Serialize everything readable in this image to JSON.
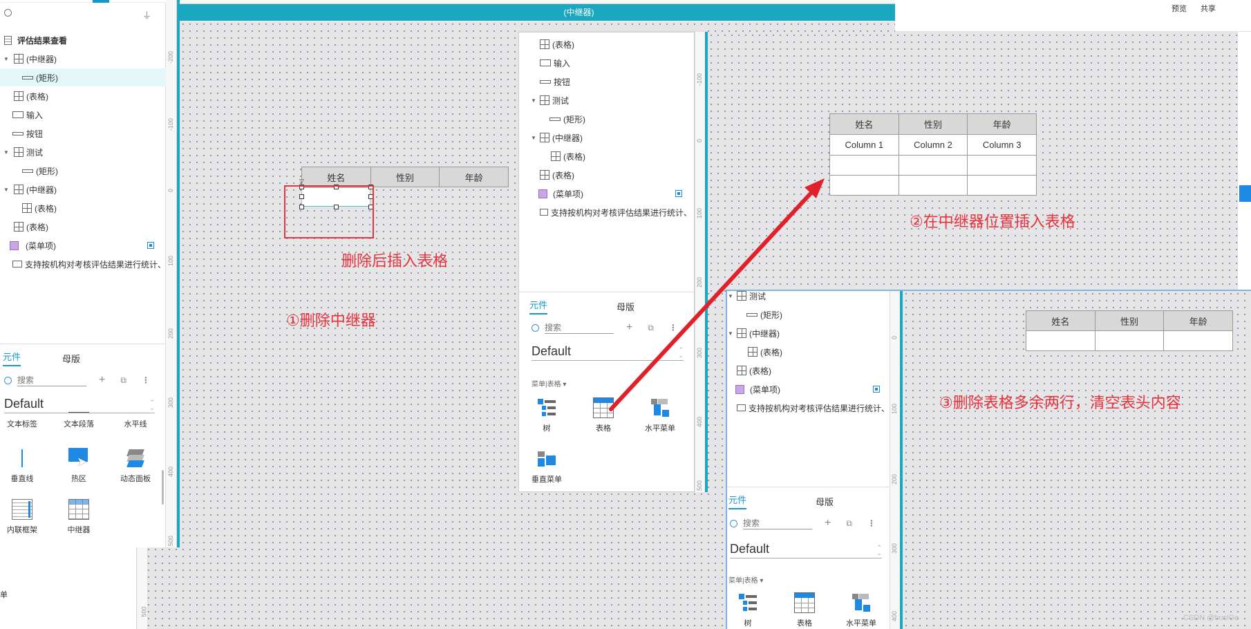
{
  "top_bar": {
    "preview": "预览",
    "share": "共享"
  },
  "canvas": {
    "repeater_title": "(中继器)"
  },
  "left_panel": {
    "outline_title": "评估结果查看",
    "tree": [
      {
        "label": "(中继器)",
        "icon": "grid-icon",
        "caret": "▼"
      },
      {
        "label": "(矩形)",
        "icon": "rect-icon",
        "caret": ""
      },
      {
        "label": "(表格)",
        "icon": "grid-icon",
        "caret": ""
      },
      {
        "label": "输入",
        "icon": "input-icon",
        "caret": ""
      },
      {
        "label": "按钮",
        "icon": "rect-icon",
        "caret": ""
      },
      {
        "label": "测试",
        "icon": "grid-icon",
        "caret": "▼"
      },
      {
        "label": "(矩形)",
        "icon": "rect-icon",
        "caret": ""
      },
      {
        "label": "(中继器)",
        "icon": "grid-icon",
        "caret": "▼"
      },
      {
        "label": "(表格)",
        "icon": "grid-icon",
        "caret": ""
      },
      {
        "label": "(表格)",
        "icon": "grid-icon",
        "caret": ""
      },
      {
        "label": "(菜单项)",
        "icon": "menu-icon",
        "caret": ""
      },
      {
        "label": "支持按机构对考核评估结果进行统计、",
        "icon": "input-icon",
        "caret": ""
      }
    ],
    "tabs": [
      "元件",
      "母版"
    ],
    "search_placeholder": "搜索",
    "library": "Default",
    "components": [
      {
        "label": "文本标签",
        "icon": "text-label-icon"
      },
      {
        "label": "文本段落",
        "icon": "text-paragraph-icon"
      },
      {
        "label": "水平线",
        "icon": "horizontal-line-icon"
      },
      {
        "label": "垂直线",
        "icon": "vertical-line-icon"
      },
      {
        "label": "热区",
        "icon": "hotspot-icon"
      },
      {
        "label": "动态面板",
        "icon": "dynamic-panel-icon"
      },
      {
        "label": "内联框架",
        "icon": "inline-frame-icon"
      },
      {
        "label": "中继器",
        "icon": "repeater-icon"
      }
    ]
  },
  "ruler_labels": {
    "left_v": [
      "-200",
      "-100",
      "0",
      "100",
      "200",
      "300",
      "400",
      "500"
    ],
    "mid_v": [
      "-100",
      "0",
      "100",
      "200",
      "300",
      "400",
      "500"
    ],
    "right_v": [
      "0",
      "100",
      "200",
      "300",
      "400"
    ],
    "bottom_left_v": [
      "500"
    ]
  },
  "table1": {
    "headers": [
      "姓名",
      "性别",
      "年龄"
    ]
  },
  "annotations": {
    "a1": "①删除中继器",
    "a2": "删除后插入表格",
    "a3": "②在中继器位置插入表格",
    "a4": "③删除表格多余两行，清空表头内容"
  },
  "mid_panel": {
    "tree": [
      {
        "label": "(表格)",
        "icon": "grid-icon",
        "caret": ""
      },
      {
        "label": "输入",
        "icon": "input-icon",
        "caret": ""
      },
      {
        "label": "按钮",
        "icon": "rect-icon",
        "caret": ""
      },
      {
        "label": "测试",
        "icon": "grid-icon",
        "caret": "▼"
      },
      {
        "label": "(矩形)",
        "icon": "rect-icon",
        "caret": ""
      },
      {
        "label": "(中继器)",
        "icon": "grid-icon",
        "caret": "▼"
      },
      {
        "label": "(表格)",
        "icon": "grid-icon",
        "caret": ""
      },
      {
        "label": "(表格)",
        "icon": "grid-icon",
        "caret": ""
      },
      {
        "label": "(菜单项)",
        "icon": "menu-icon",
        "caret": ""
      },
      {
        "label": "支持按机构对考核评估结果进行统计、",
        "icon": "input-icon",
        "caret": ""
      }
    ],
    "tabs": [
      "元件",
      "母版"
    ],
    "search_placeholder": "搜索",
    "library": "Default",
    "category": "菜单|表格 ▾",
    "components": [
      {
        "label": "树",
        "icon": "tree-icon"
      },
      {
        "label": "表格",
        "icon": "table-icon"
      },
      {
        "label": "水平菜单",
        "icon": "horizontal-menu-icon"
      },
      {
        "label": "垂直菜单",
        "icon": "vertical-menu-icon"
      }
    ]
  },
  "table2": {
    "headers": [
      "姓名",
      "性别",
      "年龄"
    ],
    "rows": [
      [
        "Column 1",
        "Column 2",
        "Column 3"
      ],
      [
        "",
        "",
        ""
      ],
      [
        "",
        "",
        ""
      ]
    ]
  },
  "br_panel": {
    "tree": [
      {
        "label": "测试",
        "icon": "grid-icon",
        "caret": "▼"
      },
      {
        "label": "(矩形)",
        "icon": "rect-icon",
        "caret": ""
      },
      {
        "label": "(中继器)",
        "icon": "grid-icon",
        "caret": "▼"
      },
      {
        "label": "(表格)",
        "icon": "grid-icon",
        "caret": ""
      },
      {
        "label": "(表格)",
        "icon": "grid-icon",
        "caret": ""
      },
      {
        "label": "(菜单项)",
        "icon": "menu-icon",
        "caret": ""
      },
      {
        "label": "支持按机构对考核评估结果进行统计、",
        "icon": "input-icon",
        "caret": ""
      }
    ],
    "tabs": [
      "元件",
      "母版"
    ],
    "search_placeholder": "搜索",
    "library": "Default",
    "category": "菜单|表格 ▾",
    "components": [
      {
        "label": "树",
        "icon": "tree-icon"
      },
      {
        "label": "表格",
        "icon": "table-icon"
      },
      {
        "label": "水平菜单",
        "icon": "horizontal-menu-icon"
      }
    ]
  },
  "table3": {
    "headers": [
      "姓名",
      "性别",
      "年龄"
    ]
  },
  "bottom_left": {
    "fragment": "单"
  },
  "watermark": "CSDN @busiGe",
  "colors": {
    "accent_teal": "#1ba7c0",
    "annotation_red": "#e8323c",
    "arrow_red": "#e0202a",
    "tab_blue": "#1797c8"
  }
}
